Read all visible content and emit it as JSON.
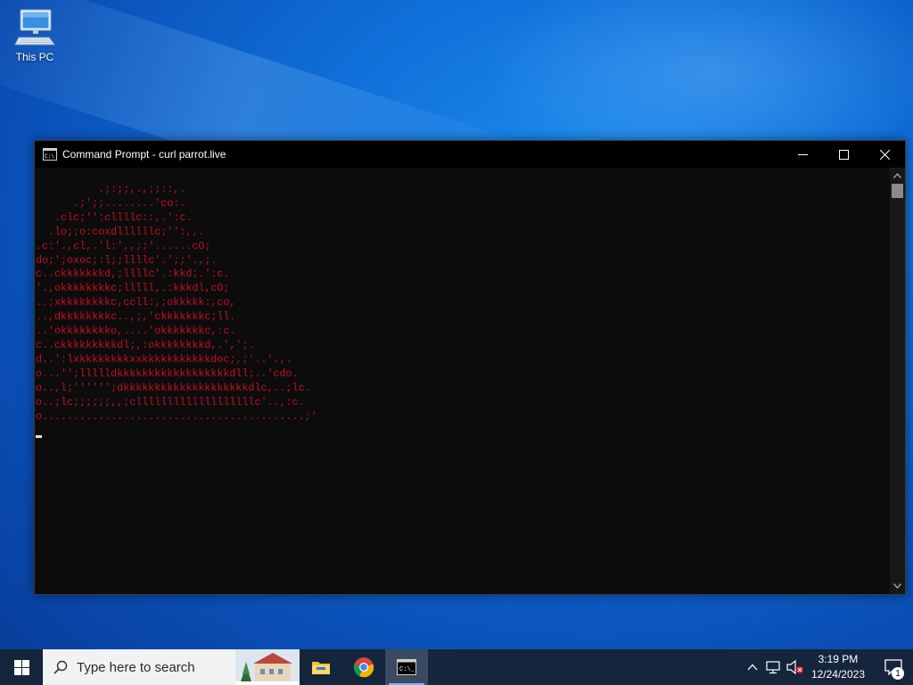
{
  "desktop": {
    "icons": [
      {
        "label": "This PC",
        "icon": "computer-icon"
      }
    ]
  },
  "window": {
    "title": "Command Prompt - curl  parrot.live",
    "icon": "cmd-icon",
    "controls": [
      "minimize-icon",
      "maximize-icon",
      "close-icon"
    ],
    "console": {
      "text_color": "#c50f1f",
      "background": "#0c0c0c",
      "ascii_art": "          .;:;;,.,;;::,.\n      .;';;........'co:.\n   .clc;'':cllllc::,.':c.\n  .lo;;o:coxdllllllc;'':,,.\n.c:'.,cl,.'l:',,;;'......cO;\ndo;';oxoc;:l;;llllc'.';;'.,;.\nc..ckkkkkkkd,;llllc'.:kkd;.':c.\n'.,okkkkkkkkc;lllll,.:kkkdl,cO;\n..;xkkkkkkkkc,ccll:,;okkkkk:,co,\n..,dkkkkkkkkc..,;,'ckkkkkkkc;ll.\n..'okkkkkkkko,....'okkkkkkkc,:c.\nc..ckkkkkkkkkdl;,:okkkkkkkkd,.',';.\nd..':lxkkkkkkkkxxkkkkkkkkkkkdoc;,;'..'.,.\no...'';llllldkkkkkkkkkkkkkkkkkkdll;..'cdo.\no..,l;'''''';dkkkkkkkkkkkkkkkkkkkkdlc,..;lc.\no..;lc;;;;;;,,;clllllllllllllllllllc'..,:c.\no..........................................;'"
    }
  },
  "taskbar": {
    "search_placeholder": "Type here to search",
    "apps": [
      {
        "name": "file-explorer-icon",
        "active": false
      },
      {
        "name": "chrome-icon",
        "active": false
      },
      {
        "name": "command-prompt-icon",
        "active": true
      }
    ],
    "tray": {
      "time": "3:19 PM",
      "date": "12/24/2023",
      "notification_count": "1"
    }
  }
}
